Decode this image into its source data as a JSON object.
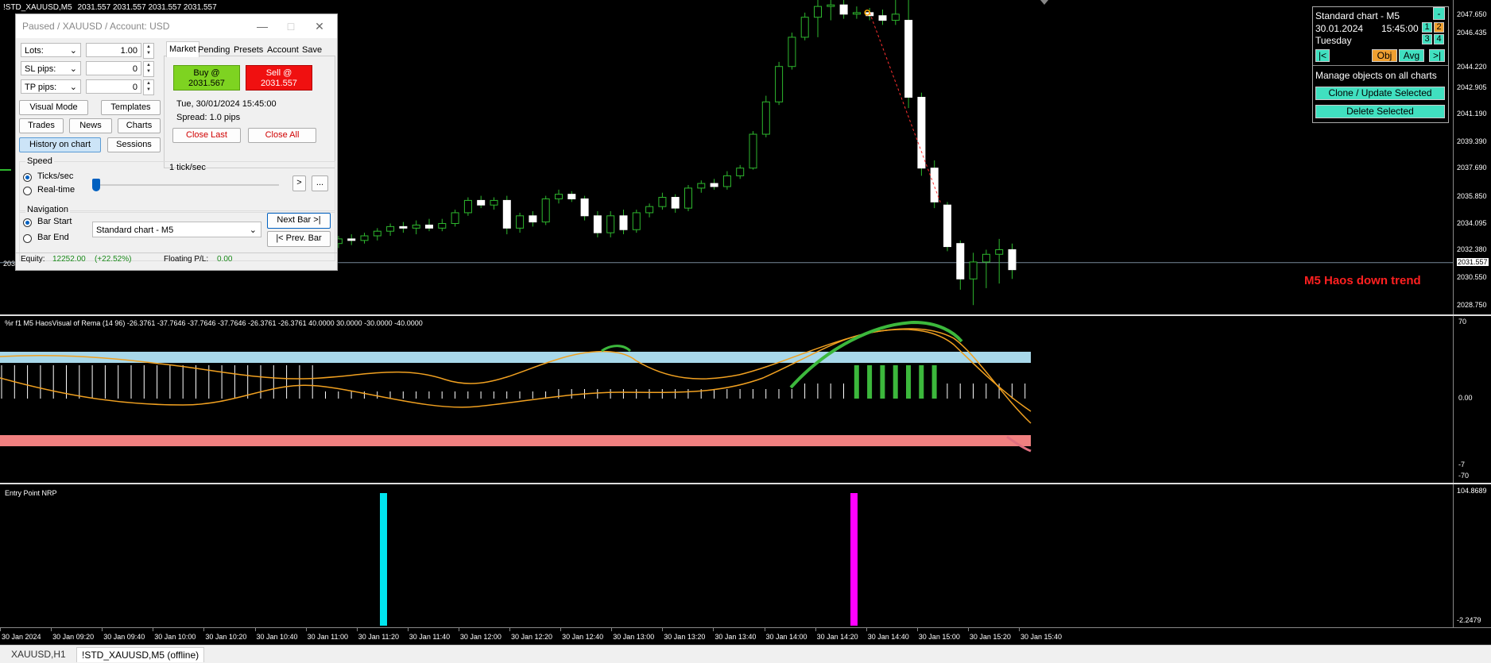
{
  "window": {
    "symbol_title": "!STD_XAUUSD,M5",
    "ohlc": "2031.557 2031.557 2031.557 2031.557"
  },
  "price_axis": {
    "labels": [
      "2047.650",
      "2046.435",
      "2044.220",
      "2042.905",
      "2041.190",
      "2039.390",
      "2037.690",
      "2035.850",
      "2034.095",
      "2032.380",
      "2031.557",
      "2030.550",
      "2028.750"
    ],
    "current_price": "2031.557"
  },
  "main_chart": {
    "annotation": "M5 Haos down trend",
    "annotation_color": "#ff2020",
    "left_partial_label": "203",
    "candles": [
      {
        "o": 2033.4,
        "h": 2034.0,
        "l": 2033.0,
        "c": 2033.6,
        "bull": true
      },
      {
        "o": 2033.7,
        "h": 2034.1,
        "l": 2031.3,
        "c": 2032.5,
        "bull": false
      },
      {
        "o": 2032.6,
        "h": 2033.2,
        "l": 2032.2,
        "c": 2032.9,
        "bull": true
      },
      {
        "o": 2032.8,
        "h": 2033.3,
        "l": 2032.5,
        "c": 2033.1,
        "bull": true
      },
      {
        "o": 2033.1,
        "h": 2033.4,
        "l": 2032.7,
        "c": 2033.0,
        "bull": false
      },
      {
        "o": 2033.0,
        "h": 2033.5,
        "l": 2032.8,
        "c": 2033.3,
        "bull": true
      },
      {
        "o": 2033.3,
        "h": 2033.8,
        "l": 2033.0,
        "c": 2033.6,
        "bull": true
      },
      {
        "o": 2033.6,
        "h": 2034.1,
        "l": 2033.3,
        "c": 2033.9,
        "bull": true
      },
      {
        "o": 2033.9,
        "h": 2034.2,
        "l": 2033.5,
        "c": 2033.8,
        "bull": false
      },
      {
        "o": 2033.8,
        "h": 2034.3,
        "l": 2033.4,
        "c": 2034.0,
        "bull": true
      },
      {
        "o": 2034.0,
        "h": 2034.4,
        "l": 2033.6,
        "c": 2033.8,
        "bull": false
      },
      {
        "o": 2033.8,
        "h": 2034.4,
        "l": 2033.6,
        "c": 2034.1,
        "bull": true
      },
      {
        "o": 2034.1,
        "h": 2035.0,
        "l": 2033.9,
        "c": 2034.8,
        "bull": true
      },
      {
        "o": 2034.8,
        "h": 2035.8,
        "l": 2034.6,
        "c": 2035.6,
        "bull": true
      },
      {
        "o": 2035.6,
        "h": 2035.9,
        "l": 2035.1,
        "c": 2035.3,
        "bull": false
      },
      {
        "o": 2035.3,
        "h": 2035.8,
        "l": 2035.0,
        "c": 2035.6,
        "bull": true
      },
      {
        "o": 2035.6,
        "h": 2035.9,
        "l": 2033.4,
        "c": 2033.8,
        "bull": false
      },
      {
        "o": 2033.8,
        "h": 2034.8,
        "l": 2033.5,
        "c": 2034.6,
        "bull": true
      },
      {
        "o": 2034.6,
        "h": 2034.9,
        "l": 2033.9,
        "c": 2034.2,
        "bull": false
      },
      {
        "o": 2034.2,
        "h": 2035.9,
        "l": 2034.0,
        "c": 2035.7,
        "bull": true
      },
      {
        "o": 2035.7,
        "h": 2036.3,
        "l": 2035.4,
        "c": 2036.0,
        "bull": true
      },
      {
        "o": 2036.0,
        "h": 2036.2,
        "l": 2035.5,
        "c": 2035.7,
        "bull": false
      },
      {
        "o": 2035.7,
        "h": 2035.9,
        "l": 2034.3,
        "c": 2034.6,
        "bull": false
      },
      {
        "o": 2034.6,
        "h": 2034.9,
        "l": 2033.2,
        "c": 2033.5,
        "bull": false
      },
      {
        "o": 2033.5,
        "h": 2034.9,
        "l": 2033.2,
        "c": 2034.6,
        "bull": true
      },
      {
        "o": 2034.6,
        "h": 2035.0,
        "l": 2033.4,
        "c": 2033.7,
        "bull": false
      },
      {
        "o": 2033.7,
        "h": 2035.0,
        "l": 2033.5,
        "c": 2034.8,
        "bull": true
      },
      {
        "o": 2034.8,
        "h": 2035.4,
        "l": 2034.5,
        "c": 2035.2,
        "bull": true
      },
      {
        "o": 2035.2,
        "h": 2036.1,
        "l": 2035.0,
        "c": 2035.8,
        "bull": true
      },
      {
        "o": 2035.8,
        "h": 2036.0,
        "l": 2034.8,
        "c": 2035.1,
        "bull": false
      },
      {
        "o": 2035.1,
        "h": 2036.6,
        "l": 2034.9,
        "c": 2036.4,
        "bull": true
      },
      {
        "o": 2036.4,
        "h": 2036.9,
        "l": 2036.1,
        "c": 2036.7,
        "bull": true
      },
      {
        "o": 2036.7,
        "h": 2037.0,
        "l": 2036.3,
        "c": 2036.5,
        "bull": false
      },
      {
        "o": 2036.5,
        "h": 2037.5,
        "l": 2036.3,
        "c": 2037.2,
        "bull": true
      },
      {
        "o": 2037.2,
        "h": 2037.9,
        "l": 2037.0,
        "c": 2037.7,
        "bull": true
      },
      {
        "o": 2037.7,
        "h": 2040.1,
        "l": 2037.6,
        "c": 2039.9,
        "bull": true
      },
      {
        "o": 2039.9,
        "h": 2042.4,
        "l": 2039.7,
        "c": 2042.0,
        "bull": true
      },
      {
        "o": 2042.0,
        "h": 2044.6,
        "l": 2041.8,
        "c": 2044.3,
        "bull": true
      },
      {
        "o": 2044.3,
        "h": 2046.5,
        "l": 2044.1,
        "c": 2046.2,
        "bull": true
      },
      {
        "o": 2046.2,
        "h": 2047.8,
        "l": 2046.0,
        "c": 2047.5,
        "bull": true
      },
      {
        "o": 2047.5,
        "h": 2048.8,
        "l": 2046.2,
        "c": 2048.2,
        "bull": true
      },
      {
        "o": 2048.2,
        "h": 2048.7,
        "l": 2047.3,
        "c": 2048.3,
        "bull": true
      },
      {
        "o": 2048.3,
        "h": 2048.8,
        "l": 2047.4,
        "c": 2047.7,
        "bull": false
      },
      {
        "o": 2047.7,
        "h": 2048.2,
        "l": 2047.4,
        "c": 2047.8,
        "bull": true
      },
      {
        "o": 2047.8,
        "h": 2048.1,
        "l": 2047.3,
        "c": 2047.6,
        "bull": false
      },
      {
        "o": 2047.6,
        "h": 2048.0,
        "l": 2047.0,
        "c": 2047.3,
        "bull": false
      },
      {
        "o": 2047.3,
        "h": 2048.7,
        "l": 2047.0,
        "c": 2047.7,
        "bull": true
      },
      {
        "o": 2047.3,
        "h": 2048.7,
        "l": 2041.6,
        "c": 2042.3,
        "bull": false
      },
      {
        "o": 2042.3,
        "h": 2042.6,
        "l": 2037.2,
        "c": 2037.7,
        "bull": false
      },
      {
        "o": 2037.7,
        "h": 2038.2,
        "l": 2035.1,
        "c": 2035.5,
        "bull": false
      },
      {
        "o": 2035.3,
        "h": 2035.5,
        "l": 2032.3,
        "c": 2032.6,
        "bull": false
      },
      {
        "o": 2032.8,
        "h": 2033.0,
        "l": 2029.8,
        "c": 2030.5,
        "bull": false
      },
      {
        "o": 2030.5,
        "h": 2032.2,
        "l": 2028.8,
        "c": 2031.6,
        "bull": true
      },
      {
        "o": 2031.6,
        "h": 2032.4,
        "l": 2029.9,
        "c": 2032.1,
        "bull": true
      },
      {
        "o": 2032.1,
        "h": 2033.1,
        "l": 2030.2,
        "c": 2032.4,
        "bull": true
      },
      {
        "o": 2032.4,
        "h": 2032.8,
        "l": 2030.5,
        "c": 2031.1,
        "bull": false
      }
    ]
  },
  "indicator1": {
    "title": "%r f1 M5 HaosVisual of Rema (14 96) -26.3761 -37.7646 -37.7646 -37.7646 -26.3761 -26.3761 40.0000 30.0000 -30.0000 -40.0000",
    "axis_labels": [
      "70",
      "0.00",
      "-7",
      "-70"
    ],
    "upper_band_color": "#a8d8ea",
    "lower_band_color": "#f08080"
  },
  "indicator2": {
    "title": "Entry Point NRP",
    "axis_top": "104.8689",
    "axis_bottom": "-2.2479",
    "signals": [
      {
        "time_index": 19,
        "color": "#00e5ee"
      },
      {
        "time_index": 46,
        "color": "#ff00ff"
      }
    ]
  },
  "time_axis": [
    "30 Jan 2024",
    "30 Jan 09:20",
    "30 Jan 09:40",
    "30 Jan 10:00",
    "30 Jan 10:20",
    "30 Jan 10:40",
    "30 Jan 11:00",
    "30 Jan 11:20",
    "30 Jan 11:40",
    "30 Jan 12:00",
    "30 Jan 12:20",
    "30 Jan 12:40",
    "30 Jan 13:00",
    "30 Jan 13:20",
    "30 Jan 13:40",
    "30 Jan 14:00",
    "30 Jan 14:20",
    "30 Jan 14:40",
    "30 Jan 15:00",
    "30 Jan 15:20",
    "30 Jan 15:40"
  ],
  "tester": {
    "title": "Paused / XAUUSD / Account: USD",
    "lots_label": "Lots:",
    "lots_value": "1.00",
    "sl_label": "SL pips:",
    "sl_value": "0",
    "tp_label": "TP pips:",
    "tp_value": "0",
    "tabs": [
      "Market",
      "Pending",
      "Presets",
      "Account",
      "Save"
    ],
    "buy_label": "Buy @",
    "buy_price": "2031.567",
    "sell_label": "Sell @",
    "sell_price": "2031.557",
    "datetime": "Tue, 30/01/2024  15:45:00",
    "spread": "Spread: 1.0 pips",
    "close_last": "Close Last",
    "close_all": "Close All",
    "visual_mode": "Visual Mode",
    "templates": "Templates",
    "trades": "Trades",
    "news": "News",
    "charts": "Charts",
    "history_on_chart": "History on chart",
    "sessions": "Sessions",
    "speed_label": "Speed",
    "speed_value": "1 tick/sec",
    "ticks_sec": "Ticks/sec",
    "real_time": "Real-time",
    "speed_next": ">",
    "speed_more": "...",
    "navigation_label": "Navigation",
    "bar_start": "Bar Start",
    "bar_end": "Bar End",
    "chart_select": "Standard chart - M5",
    "next_bar": "Next Bar >|",
    "prev_bar": "|< Prev. Bar",
    "equity_label": "Equity:",
    "equity_value": "12252.00",
    "equity_pct": "(+22.52%)",
    "floating_label": "Floating P/L:",
    "floating_value": "0.00"
  },
  "info_panel": {
    "chart_name": "Standard chart - M5",
    "date": "30.01.2024",
    "time": "15:45:00",
    "day": "Tuesday",
    "min_btn": "-",
    "num_btns": [
      "1",
      "2",
      "3",
      "4"
    ],
    "first_btn": "|<",
    "obj_btn": "Obj",
    "avg_btn": "Avg",
    "last_btn": ">|",
    "manage_text": "Manage objects on all charts",
    "clone_btn": "Clone / Update Selected",
    "delete_btn": "Delete Selected"
  },
  "bottom_tabs": [
    "XAUUSD,H1",
    "!STD_XAUUSD,M5 (offline)"
  ]
}
